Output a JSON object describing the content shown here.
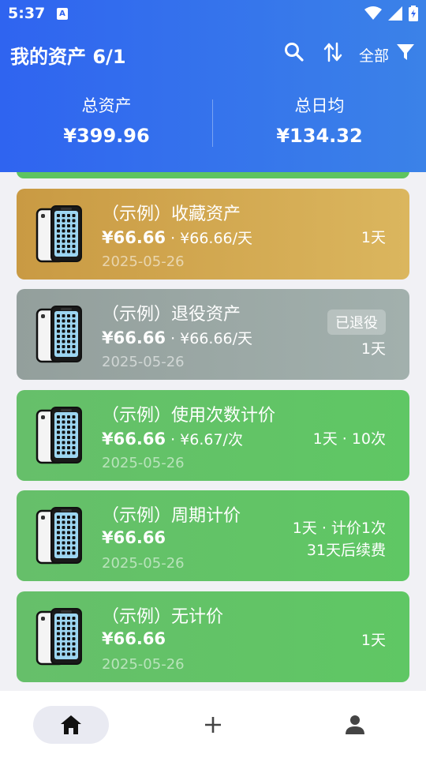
{
  "status_bar": {
    "time": "5:37",
    "app_icon_letter": "A"
  },
  "header": {
    "title": "我的资产 6/1",
    "filter_label": "全部",
    "total_assets_label": "总资产",
    "total_assets_value": "¥399.96",
    "daily_avg_label": "总日均",
    "daily_avg_value": "¥134.32"
  },
  "colors": {
    "header_start": "#2f64f0",
    "header_end": "#3b82e8",
    "gold": "#d4a94e",
    "gray": "#97a5a2",
    "green": "#5ec460"
  },
  "cards": [
    {
      "name": "（示例）收藏资产",
      "price": "¥66.66",
      "price_sub": " · ¥66.66/天",
      "date": "2025-05-26",
      "right_line1": "1天",
      "right_line2": "",
      "badge": "",
      "color": "gold"
    },
    {
      "name": "（示例）退役资产",
      "price": "¥66.66",
      "price_sub": " · ¥66.66/天",
      "date": "2025-05-26",
      "right_line1": "1天",
      "right_line2": "",
      "badge": "已退役",
      "color": "gray"
    },
    {
      "name": "（示例）使用次数计价",
      "price": "¥66.66",
      "price_sub": " · ¥6.67/次",
      "date": "2025-05-26",
      "right_line1": "1天 · 10次",
      "right_line2": "",
      "badge": "",
      "color": "green"
    },
    {
      "name": "（示例）周期计价",
      "price": "¥66.66",
      "price_sub": "",
      "date": "2025-05-26",
      "right_line1": "1天 · 计价1次",
      "right_line2": "31天后续费",
      "badge": "",
      "color": "green"
    },
    {
      "name": "（示例）无计价",
      "price": "¥66.66",
      "price_sub": "",
      "date": "2025-05-26",
      "right_line1": "1天",
      "right_line2": "",
      "badge": "",
      "color": "green"
    }
  ],
  "icons": {
    "search": "search-icon",
    "sort": "sort-icon",
    "filter": "filter-icon",
    "home": "home-icon",
    "add": "add-icon",
    "profile": "person-icon",
    "phone": "phone-icon"
  }
}
